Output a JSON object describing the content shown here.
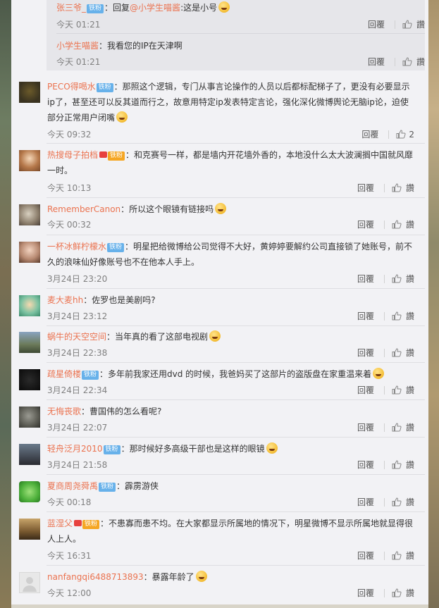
{
  "ui": {
    "reply_label": "回覆"
  },
  "replies": [
    {
      "user": "张三爷_",
      "badge": "铁粉",
      "text_pre": "：回复",
      "mention": "@小学生喵酱",
      "text_post": ":这是小号",
      "time": "今天 01:21",
      "likes": ""
    },
    {
      "user": "小学生喵酱",
      "badge": "",
      "text_pre": "：我看您的IP在天津啊",
      "mention": "",
      "text_post": "",
      "time": "今天 01:21",
      "likes": ""
    }
  ],
  "comments": [
    {
      "user": "PECO得喝水",
      "badge": "铁粉",
      "text": "：那照这个逻辑，专门从事言论操作的人员以后都标配梯子了，更没有必要显示ip了，甚至还可以反其道而行之，故意用特定ip发表特定言论，强化深化微博舆论无脑ip论，迫使部分正常用户闭嘴",
      "emoji": "grin-emoji",
      "time": "今天 09:32",
      "likes": "2"
    },
    {
      "user": "热搜母子拍档",
      "badge": "铁粉",
      "badge_style": "gold",
      "text": "：和克赛号一样，都是墙内开花墙外香的，本地没什么太大波澜搁中国就风靡一时。",
      "emoji": "",
      "time": "今天 10:13",
      "likes": ""
    },
    {
      "user": "RememberCanon",
      "badge": "",
      "text": "：所以这个眼镜有链接吗",
      "emoji": "laugh-cry-emoji",
      "time": "今天 00:32",
      "likes": ""
    },
    {
      "user": "一杯冰鲜柠檬水",
      "badge": "铁粉",
      "text": "：明星把给微博给公司觉得不大好，黄婷婷要解约公司直接锁了她账号，前不久的浪味仙好像账号也不在他本人手上。",
      "emoji": "",
      "time": "3月24日 23:20",
      "likes": ""
    },
    {
      "user": "麦大麦hh",
      "badge": "",
      "text": "：佐罗也是美剧吗?",
      "emoji": "",
      "time": "3月24日 23:12",
      "likes": ""
    },
    {
      "user": "蜗牛的天空空间",
      "badge": "",
      "text": "：当年真的看了这部电视剧",
      "emoji": "shy-emoji",
      "time": "3月24日 22:38",
      "likes": ""
    },
    {
      "user": "疏星倚楼",
      "badge": "铁粉",
      "text": "：多年前我家还用dvd 的时候，我爸妈买了这部片的盗版盘在家重温来着",
      "emoji": "cat-emoji",
      "time": "3月24日 22:34",
      "likes": ""
    },
    {
      "user": "无悔丧歌",
      "badge": "",
      "text": "：曹国伟的怎么看呢?",
      "emoji": "",
      "time": "3月24日 22:07",
      "likes": ""
    },
    {
      "user": "轻舟泛月2010",
      "badge": "铁粉",
      "text": "：那时候好多高级干部也是这样的眼镜",
      "emoji": "smirk-emoji",
      "time": "3月24日 21:58",
      "likes": ""
    },
    {
      "user": "夏商周尧舜禹",
      "badge": "铁粉",
      "text": "：霹雳游侠",
      "emoji": "",
      "time": "今天 00:18",
      "likes": ""
    },
    {
      "user": "蓝湿父",
      "badge": "铁粉",
      "badge_style": "gold",
      "text": "：不患寡而患不均。在大家都显示所属地的情况下，明星微博不显示所属地就显得很人上人。",
      "emoji": "",
      "time": "今天 16:31",
      "likes": ""
    },
    {
      "user": "nanfangqi6488713893",
      "badge": "",
      "text": "：暴露年龄了",
      "emoji": "grin-emoji",
      "time": "今天 12:00",
      "likes": ""
    }
  ]
}
